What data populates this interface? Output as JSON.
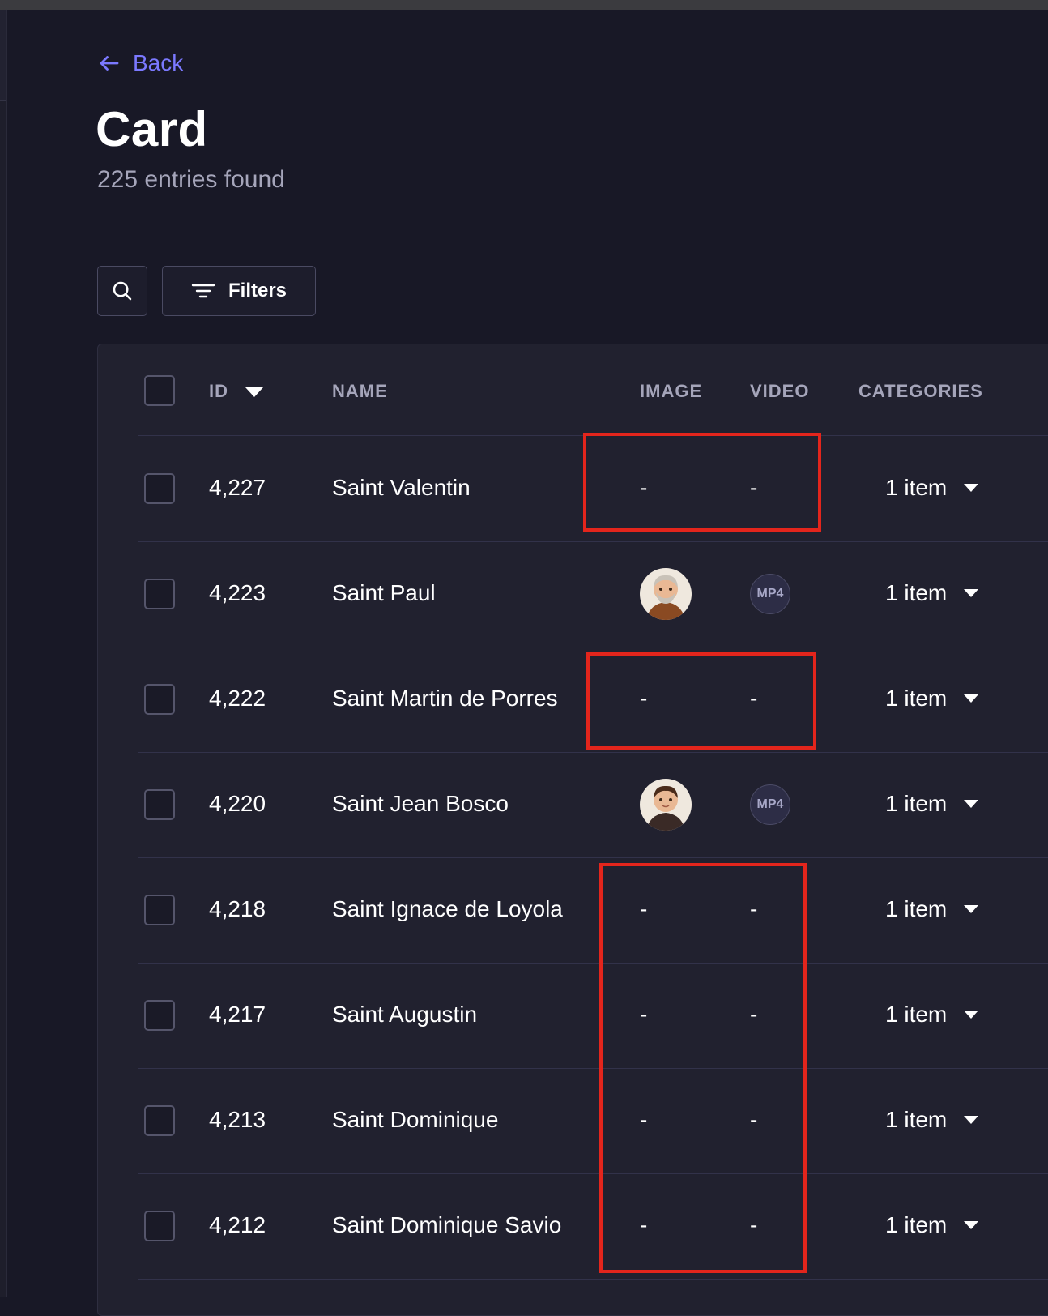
{
  "nav": {
    "back_label": "Back"
  },
  "header": {
    "title": "Card",
    "subtitle": "225 entries found"
  },
  "toolbar": {
    "filters_label": "Filters"
  },
  "table": {
    "columns": {
      "id": "ID",
      "name": "NAME",
      "image": "IMAGE",
      "video": "VIDEO",
      "categories": "CATEGORIES"
    },
    "rows": [
      {
        "id": "4,227",
        "name": "Saint Valentin",
        "image": "-",
        "video": "-",
        "categories": "1 item"
      },
      {
        "id": "4,223",
        "name": "Saint Paul",
        "image": "avatar",
        "video": "MP4",
        "categories": "1 item"
      },
      {
        "id": "4,222",
        "name": "Saint Martin de Porres",
        "image": "-",
        "video": "-",
        "categories": "1 item"
      },
      {
        "id": "4,220",
        "name": "Saint Jean Bosco",
        "image": "avatar",
        "video": "MP4",
        "categories": "1 item"
      },
      {
        "id": "4,218",
        "name": "Saint Ignace de Loyola",
        "image": "-",
        "video": "-",
        "categories": "1 item"
      },
      {
        "id": "4,217",
        "name": "Saint Augustin",
        "image": "-",
        "video": "-",
        "categories": "1 item"
      },
      {
        "id": "4,213",
        "name": "Saint Dominique",
        "image": "-",
        "video": "-",
        "categories": "1 item"
      },
      {
        "id": "4,212",
        "name": "Saint Dominique Savio",
        "image": "-",
        "video": "-",
        "categories": "1 item"
      }
    ]
  },
  "colors": {
    "accent": "#7b79ff",
    "background": "#181826",
    "surface": "#21212f",
    "highlight": "#e3251c"
  }
}
